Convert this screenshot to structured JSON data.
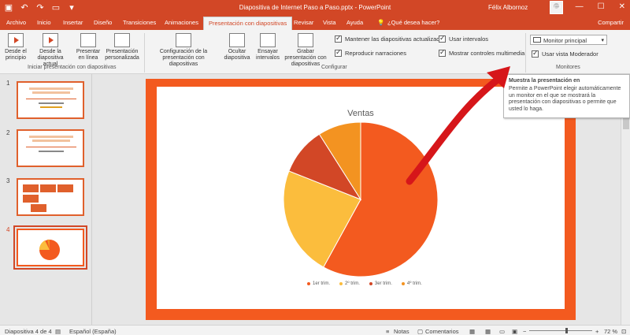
{
  "window": {
    "title": "Diapositiva de Internet Paso a Paso.pptx - PowerPoint",
    "user": "Félix Albornoz",
    "share": "Compartir"
  },
  "tabs": [
    "Archivo",
    "Inicio",
    "Insertar",
    "Diseño",
    "Transiciones",
    "Animaciones",
    "Presentación con diapositivas",
    "Revisar",
    "Vista",
    "Ayuda",
    "¿Qué desea hacer?"
  ],
  "ribbon": {
    "group1_label": "Iniciar presentación con diapositivas",
    "group2_label": "Configurar",
    "group3_label": "Monitores",
    "buttons": {
      "from_start": "Desde el principio",
      "from_current": "Desde la diapositiva actual",
      "present_online": "Presentar en línea",
      "custom_show": "Presentación personalizada",
      "setup_show": "Configuración de la presentación con diapositivas",
      "hide_slide": "Ocultar diapositiva",
      "rehearse": "Ensayar intervalos",
      "record": "Grabar presentación con diapositivas"
    },
    "checks": {
      "keep_updated": "Mantener las diapositivas actualizadas",
      "play_narrations": "Reproducir narraciones",
      "use_timings": "Usar intervalos",
      "show_media": "Mostrar controles multimedia",
      "presenter_view": "Usar vista Moderador"
    },
    "monitor_value": "Monitor principal"
  },
  "tooltip": {
    "title": "Muestra la presentación en",
    "body": "Permite a PowerPoint elegir automáticamente un monitor en el que se mostrará la presentación con diapositivas o permite que usted lo haga."
  },
  "thumbnails": [
    "1",
    "2",
    "3",
    "4"
  ],
  "chart_data": {
    "type": "pie",
    "title": "Ventas",
    "categories": [
      "1er trim.",
      "2º trim.",
      "3er trim.",
      "4º trim."
    ],
    "values": [
      58,
      23,
      10,
      9
    ],
    "colors": [
      "#f35a1f",
      "#fbbd3d",
      "#d24726",
      "#f39321"
    ]
  },
  "status": {
    "slide_info": "Diapositiva 4 de 4",
    "language": "Español (España)",
    "notes": "Notas",
    "comments": "Comentarios",
    "zoom": "72 %"
  },
  "colors": {
    "accent": "#d24726",
    "slide_border": "#f35a1f"
  }
}
